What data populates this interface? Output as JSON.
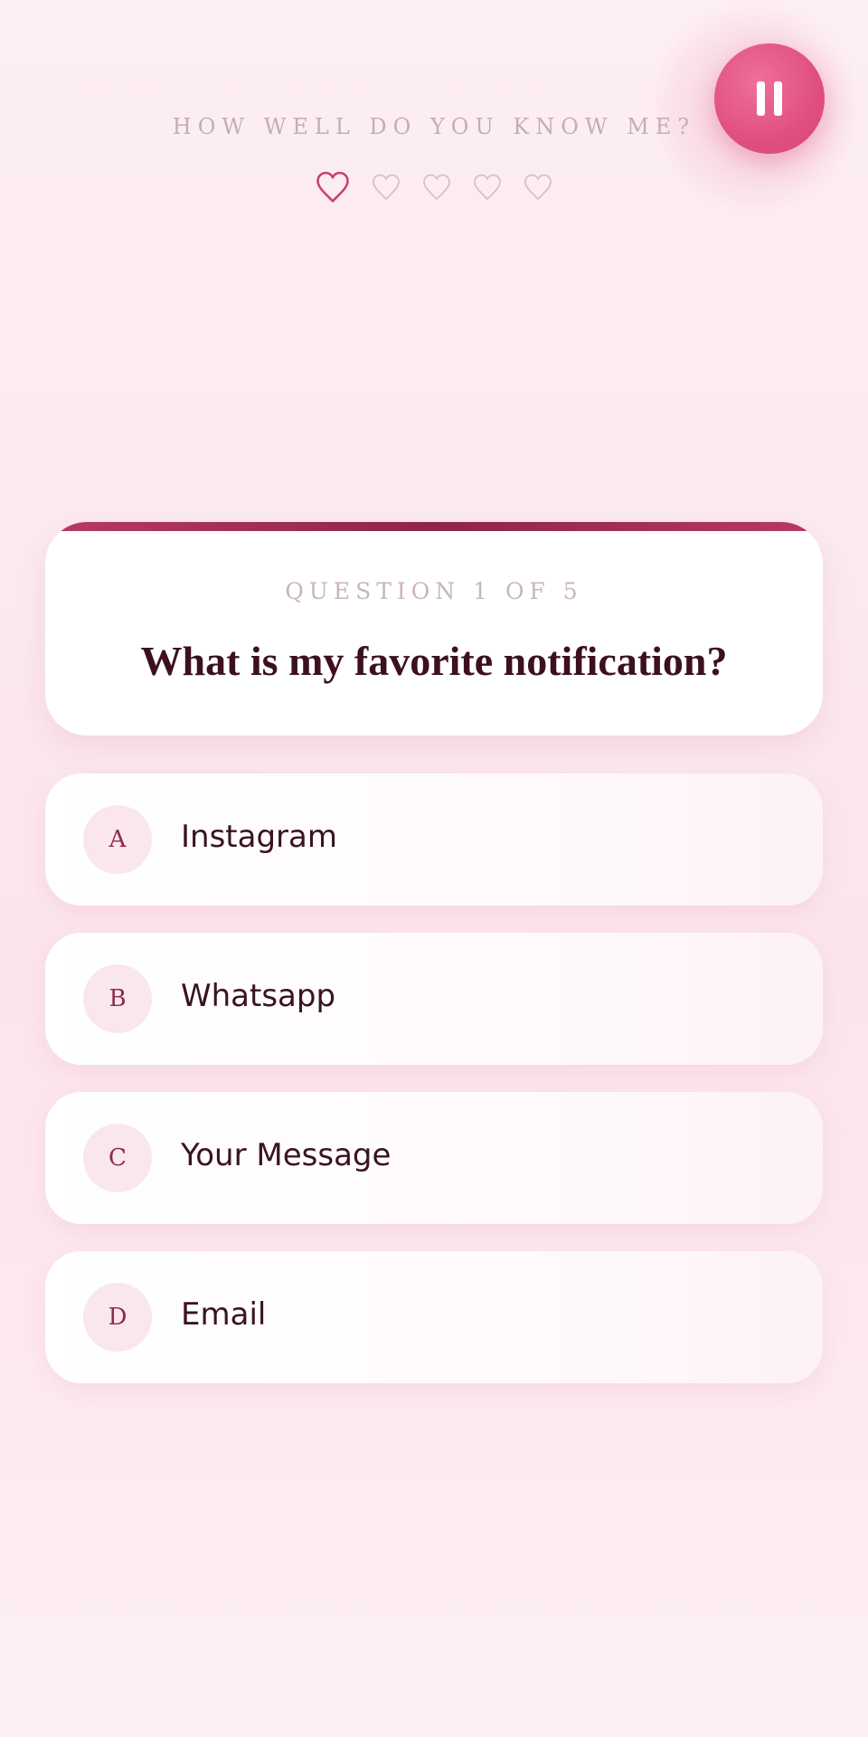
{
  "header": {
    "title": "HOW WELL DO YOU KNOW ME?",
    "pause_icon": "pause-icon",
    "progress": {
      "total": 5,
      "current": 1,
      "icon": "heart-outline-icon"
    }
  },
  "question": {
    "counter": "QUESTION 1 OF 5",
    "text": "What is my favorite notification?"
  },
  "options": [
    {
      "letter": "A",
      "label": "Instagram"
    },
    {
      "letter": "B",
      "label": "Whatsapp"
    },
    {
      "letter": "C",
      "label": "Your Message"
    },
    {
      "letter": "D",
      "label": "Email"
    }
  ],
  "colors": {
    "accent": "#e0507f",
    "accent_dark": "#8e2545",
    "text_dark": "#3c1020",
    "muted": "#c2aeb5",
    "heart_active": "#c8416e",
    "heart_inactive": "#d4c1c8"
  }
}
